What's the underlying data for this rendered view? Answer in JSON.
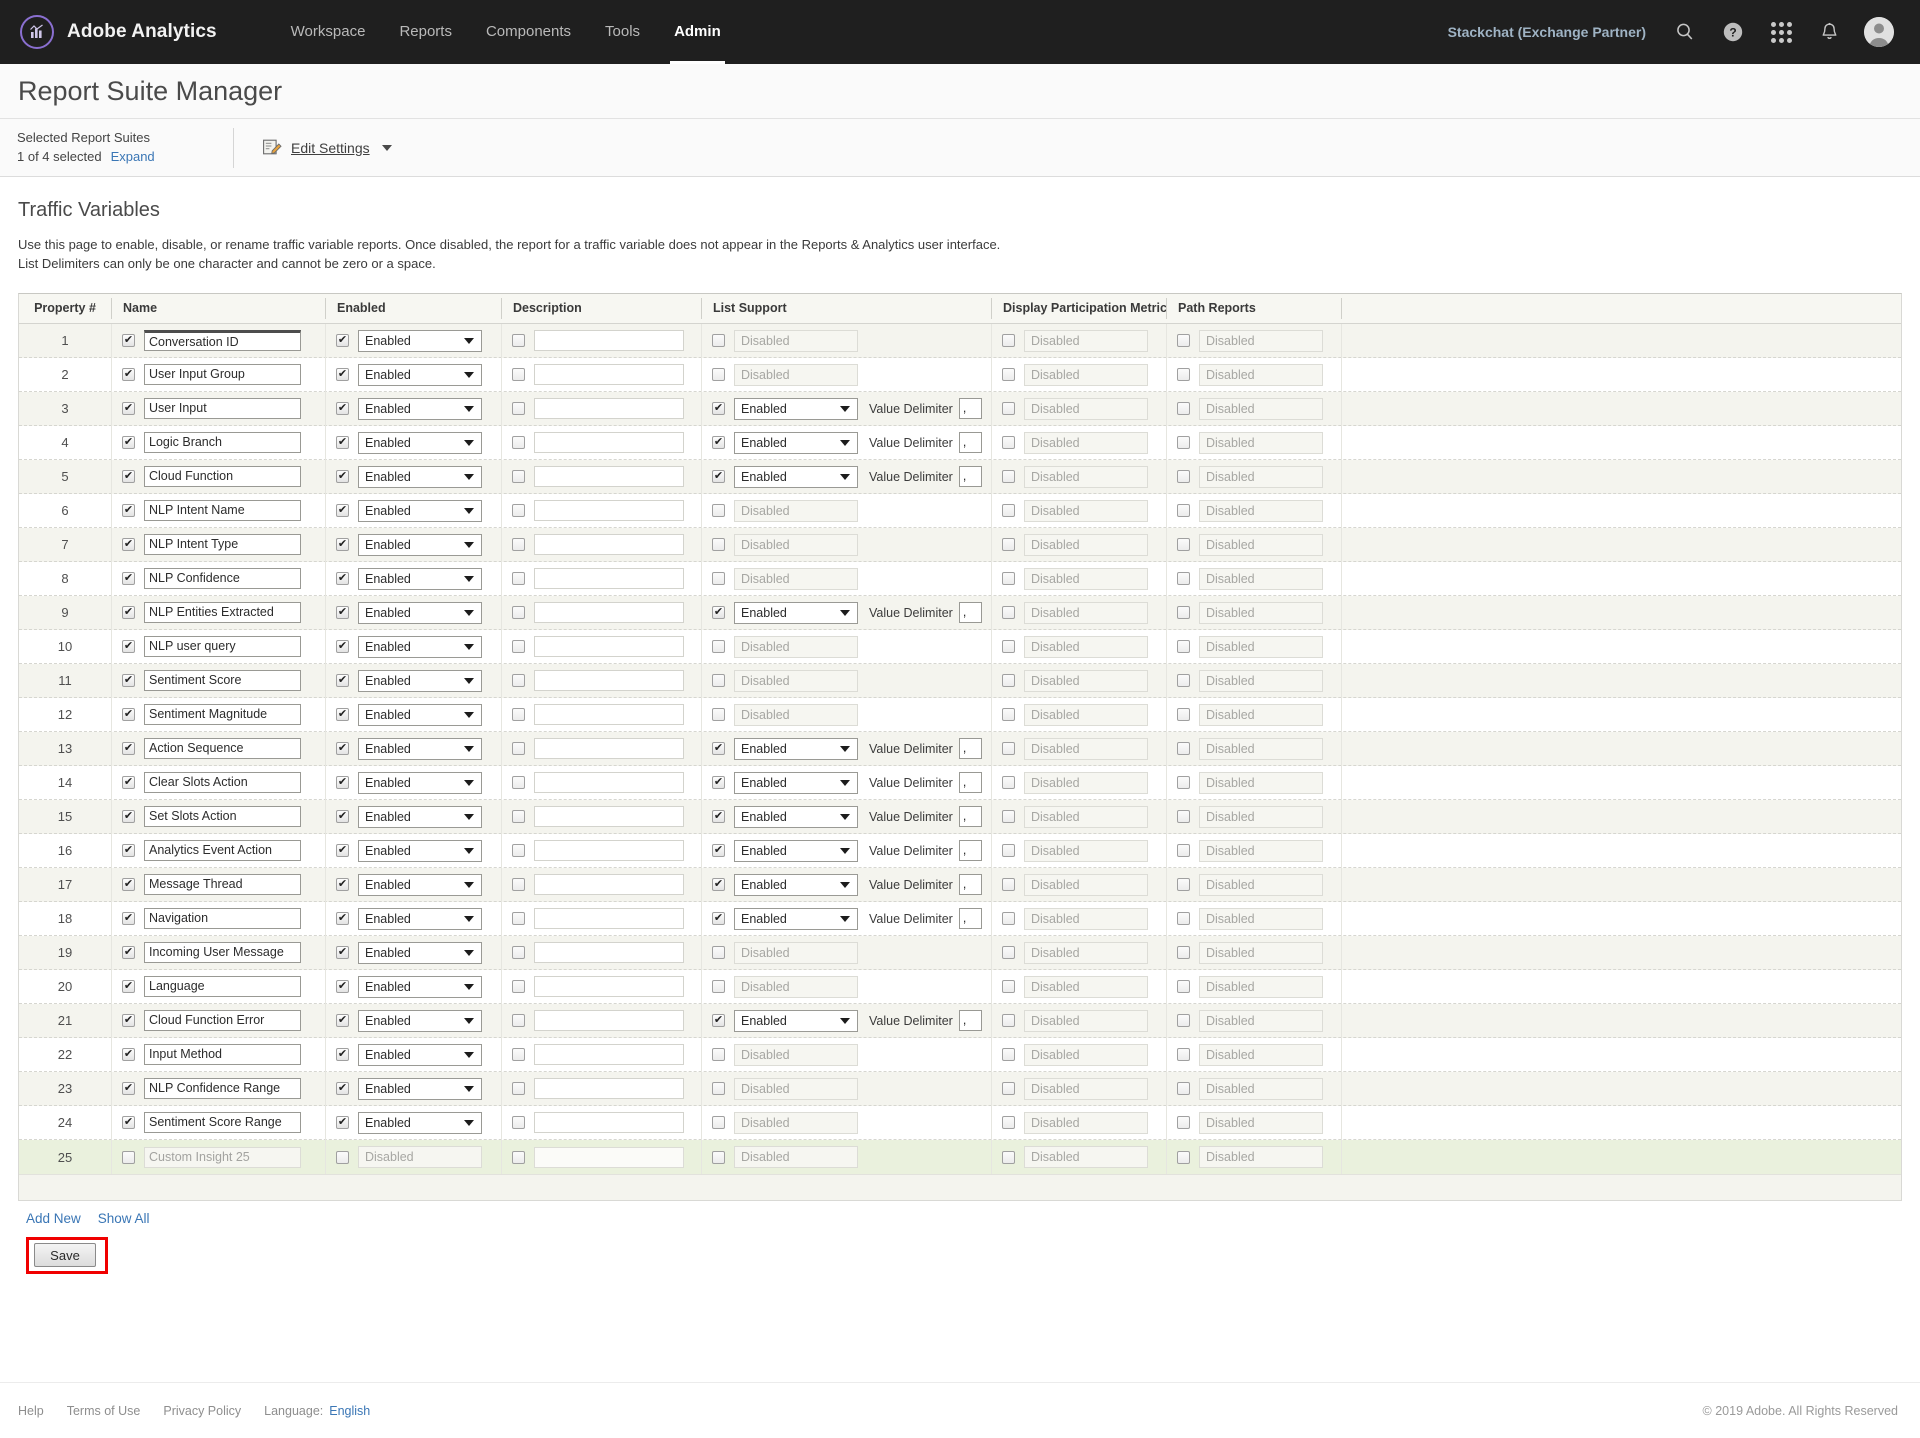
{
  "topnav": {
    "brand": "Adobe Analytics",
    "menu": [
      {
        "label": "Workspace",
        "active": false
      },
      {
        "label": "Reports",
        "active": false
      },
      {
        "label": "Components",
        "active": false
      },
      {
        "label": "Tools",
        "active": false
      },
      {
        "label": "Admin",
        "active": true
      }
    ],
    "org": "Stackchat (Exchange Partner)",
    "icons": [
      "search-icon",
      "help-icon",
      "app-grid-icon",
      "notifications-bell-icon",
      "user-avatar"
    ]
  },
  "page": {
    "title": "Report Suite Manager"
  },
  "suite_bar": {
    "label": "Selected Report Suites",
    "selected_text": "1 of 4 selected",
    "expand_link": "Expand",
    "edit_settings": "Edit Settings"
  },
  "section": {
    "title": "Traffic Variables",
    "desc_line1": "Use this page to enable, disable, or rename traffic variable reports. Once disabled, the report for a traffic variable does not appear in the Reports & Analytics user interface.",
    "desc_line2": "List Delimiters can only be one character and cannot be zero or a space."
  },
  "table": {
    "columns": [
      "Property #",
      "Name",
      "Enabled",
      "Description",
      "List Support",
      "Display Participation Metrics",
      "Path Reports"
    ],
    "labels": {
      "enabled": "Enabled",
      "disabled": "Disabled",
      "value_delimiter": "Value Delimiter",
      "delimiter_value": ","
    },
    "rows": [
      {
        "num": "1",
        "name": "Conversation ID",
        "name_checked": true,
        "name_focused": true,
        "enabled_checked": true,
        "enabled": "Enabled",
        "desc_checked": false,
        "list_checked": false,
        "list": "Disabled",
        "delim": ",",
        "disp_checked": false,
        "disp": "Disabled",
        "path_checked": false,
        "path": "Disabled"
      },
      {
        "num": "2",
        "name": "User Input Group",
        "name_checked": true,
        "name_focused": false,
        "enabled_checked": true,
        "enabled": "Enabled",
        "desc_checked": false,
        "list_checked": false,
        "list": "Disabled",
        "delim": ",",
        "disp_checked": false,
        "disp": "Disabled",
        "path_checked": false,
        "path": "Disabled"
      },
      {
        "num": "3",
        "name": "User Input",
        "name_checked": true,
        "name_focused": false,
        "enabled_checked": true,
        "enabled": "Enabled",
        "desc_checked": false,
        "list_checked": true,
        "list": "Enabled",
        "delim": ",",
        "disp_checked": false,
        "disp": "Disabled",
        "path_checked": false,
        "path": "Disabled"
      },
      {
        "num": "4",
        "name": "Logic Branch",
        "name_checked": true,
        "name_focused": false,
        "enabled_checked": true,
        "enabled": "Enabled",
        "desc_checked": false,
        "list_checked": true,
        "list": "Enabled",
        "delim": ",",
        "disp_checked": false,
        "disp": "Disabled",
        "path_checked": false,
        "path": "Disabled"
      },
      {
        "num": "5",
        "name": "Cloud Function",
        "name_checked": true,
        "name_focused": false,
        "enabled_checked": true,
        "enabled": "Enabled",
        "desc_checked": false,
        "list_checked": true,
        "list": "Enabled",
        "delim": ",",
        "disp_checked": false,
        "disp": "Disabled",
        "path_checked": false,
        "path": "Disabled"
      },
      {
        "num": "6",
        "name": "NLP Intent Name",
        "name_checked": true,
        "name_focused": false,
        "enabled_checked": true,
        "enabled": "Enabled",
        "desc_checked": false,
        "list_checked": false,
        "list": "Disabled",
        "delim": ",",
        "disp_checked": false,
        "disp": "Disabled",
        "path_checked": false,
        "path": "Disabled"
      },
      {
        "num": "7",
        "name": "NLP Intent Type",
        "name_checked": true,
        "name_focused": false,
        "enabled_checked": true,
        "enabled": "Enabled",
        "desc_checked": false,
        "list_checked": false,
        "list": "Disabled",
        "delim": ",",
        "disp_checked": false,
        "disp": "Disabled",
        "path_checked": false,
        "path": "Disabled"
      },
      {
        "num": "8",
        "name": "NLP Confidence",
        "name_checked": true,
        "name_focused": false,
        "enabled_checked": true,
        "enabled": "Enabled",
        "desc_checked": false,
        "list_checked": false,
        "list": "Disabled",
        "delim": ",",
        "disp_checked": false,
        "disp": "Disabled",
        "path_checked": false,
        "path": "Disabled"
      },
      {
        "num": "9",
        "name": "NLP Entities Extracted",
        "name_checked": true,
        "name_focused": false,
        "enabled_checked": true,
        "enabled": "Enabled",
        "desc_checked": false,
        "list_checked": true,
        "list": "Enabled",
        "delim": ",",
        "disp_checked": false,
        "disp": "Disabled",
        "path_checked": false,
        "path": "Disabled"
      },
      {
        "num": "10",
        "name": "NLP user query",
        "name_checked": true,
        "name_focused": false,
        "enabled_checked": true,
        "enabled": "Enabled",
        "desc_checked": false,
        "list_checked": false,
        "list": "Disabled",
        "delim": ",",
        "disp_checked": false,
        "disp": "Disabled",
        "path_checked": false,
        "path": "Disabled"
      },
      {
        "num": "11",
        "name": "Sentiment Score",
        "name_checked": true,
        "name_focused": false,
        "enabled_checked": true,
        "enabled": "Enabled",
        "desc_checked": false,
        "list_checked": false,
        "list": "Disabled",
        "delim": ",",
        "disp_checked": false,
        "disp": "Disabled",
        "path_checked": false,
        "path": "Disabled"
      },
      {
        "num": "12",
        "name": "Sentiment Magnitude",
        "name_checked": true,
        "name_focused": false,
        "enabled_checked": true,
        "enabled": "Enabled",
        "desc_checked": false,
        "list_checked": false,
        "list": "Disabled",
        "delim": ",",
        "disp_checked": false,
        "disp": "Disabled",
        "path_checked": false,
        "path": "Disabled"
      },
      {
        "num": "13",
        "name": "Action Sequence",
        "name_checked": true,
        "name_focused": false,
        "enabled_checked": true,
        "enabled": "Enabled",
        "desc_checked": false,
        "list_checked": true,
        "list": "Enabled",
        "delim": ",",
        "disp_checked": false,
        "disp": "Disabled",
        "path_checked": false,
        "path": "Disabled"
      },
      {
        "num": "14",
        "name": "Clear Slots Action",
        "name_checked": true,
        "name_focused": false,
        "enabled_checked": true,
        "enabled": "Enabled",
        "desc_checked": false,
        "list_checked": true,
        "list": "Enabled",
        "delim": ",",
        "disp_checked": false,
        "disp": "Disabled",
        "path_checked": false,
        "path": "Disabled"
      },
      {
        "num": "15",
        "name": "Set Slots Action",
        "name_checked": true,
        "name_focused": false,
        "enabled_checked": true,
        "enabled": "Enabled",
        "desc_checked": false,
        "list_checked": true,
        "list": "Enabled",
        "delim": ",",
        "disp_checked": false,
        "disp": "Disabled",
        "path_checked": false,
        "path": "Disabled"
      },
      {
        "num": "16",
        "name": "Analytics Event Action",
        "name_checked": true,
        "name_focused": false,
        "enabled_checked": true,
        "enabled": "Enabled",
        "desc_checked": false,
        "list_checked": true,
        "list": "Enabled",
        "delim": ",",
        "disp_checked": false,
        "disp": "Disabled",
        "path_checked": false,
        "path": "Disabled"
      },
      {
        "num": "17",
        "name": "Message Thread",
        "name_checked": true,
        "name_focused": false,
        "enabled_checked": true,
        "enabled": "Enabled",
        "desc_checked": false,
        "list_checked": true,
        "list": "Enabled",
        "delim": ",",
        "disp_checked": false,
        "disp": "Disabled",
        "path_checked": false,
        "path": "Disabled"
      },
      {
        "num": "18",
        "name": "Navigation",
        "name_checked": true,
        "name_focused": false,
        "enabled_checked": true,
        "enabled": "Enabled",
        "desc_checked": false,
        "list_checked": true,
        "list": "Enabled",
        "delim": ",",
        "disp_checked": false,
        "disp": "Disabled",
        "path_checked": false,
        "path": "Disabled"
      },
      {
        "num": "19",
        "name": "Incoming User Message",
        "name_checked": true,
        "name_focused": false,
        "enabled_checked": true,
        "enabled": "Enabled",
        "desc_checked": false,
        "list_checked": false,
        "list": "Disabled",
        "delim": ",",
        "disp_checked": false,
        "disp": "Disabled",
        "path_checked": false,
        "path": "Disabled"
      },
      {
        "num": "20",
        "name": "Language",
        "name_checked": true,
        "name_focused": false,
        "enabled_checked": true,
        "enabled": "Enabled",
        "desc_checked": false,
        "list_checked": false,
        "list": "Disabled",
        "delim": ",",
        "disp_checked": false,
        "disp": "Disabled",
        "path_checked": false,
        "path": "Disabled"
      },
      {
        "num": "21",
        "name": "Cloud Function Error",
        "name_checked": true,
        "name_focused": false,
        "enabled_checked": true,
        "enabled": "Enabled",
        "desc_checked": false,
        "list_checked": true,
        "list": "Enabled",
        "delim": ",",
        "disp_checked": false,
        "disp": "Disabled",
        "path_checked": false,
        "path": "Disabled"
      },
      {
        "num": "22",
        "name": "Input Method",
        "name_checked": true,
        "name_focused": false,
        "enabled_checked": true,
        "enabled": "Enabled",
        "desc_checked": false,
        "list_checked": false,
        "list": "Disabled",
        "delim": ",",
        "disp_checked": false,
        "disp": "Disabled",
        "path_checked": false,
        "path": "Disabled"
      },
      {
        "num": "23",
        "name": "NLP Confidence Range",
        "name_checked": true,
        "name_focused": false,
        "enabled_checked": true,
        "enabled": "Enabled",
        "desc_checked": false,
        "list_checked": false,
        "list": "Disabled",
        "delim": ",",
        "disp_checked": false,
        "disp": "Disabled",
        "path_checked": false,
        "path": "Disabled"
      },
      {
        "num": "24",
        "name": "Sentiment Score Range",
        "name_checked": true,
        "name_focused": false,
        "enabled_checked": true,
        "enabled": "Enabled",
        "desc_checked": false,
        "list_checked": false,
        "list": "Disabled",
        "delim": ",",
        "disp_checked": false,
        "disp": "Disabled",
        "path_checked": false,
        "path": "Disabled"
      },
      {
        "num": "25",
        "name": "Custom Insight 25",
        "name_checked": false,
        "name_focused": false,
        "enabled_checked": false,
        "enabled": "Disabled",
        "desc_checked": false,
        "list_checked": false,
        "list": "Disabled",
        "delim": ",",
        "disp_checked": false,
        "disp": "Disabled",
        "path_checked": false,
        "path": "Disabled",
        "inactive": true
      }
    ]
  },
  "actions": {
    "add_new": "Add New",
    "show_all": "Show All",
    "save": "Save"
  },
  "footer": {
    "help": "Help",
    "terms": "Terms of Use",
    "privacy": "Privacy Policy",
    "language_label": "Language:",
    "language_value": "English",
    "copyright": "© 2019 Adobe. All Rights Reserved"
  },
  "colors": {
    "nav_bg": "#1f1f1f",
    "link": "#3a76b5",
    "highlight_red": "#f00000",
    "row_alt": "#f4f4ee",
    "row_inactive": "#eaf1dd"
  }
}
